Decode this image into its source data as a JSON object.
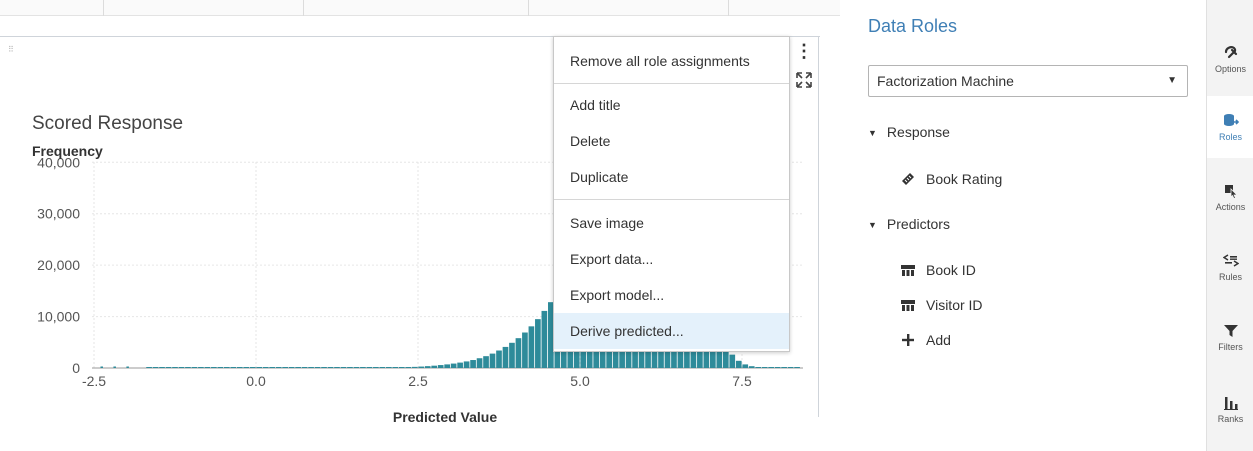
{
  "chart": {
    "title": "Scored Response",
    "y_label": "Frequency",
    "x_label": "Predicted Value"
  },
  "chart_data": {
    "type": "bar",
    "title": "Scored Response",
    "xlabel": "Predicted Value",
    "ylabel": "Frequency",
    "xlim": [
      -2.5,
      8.4
    ],
    "ylim": [
      0,
      42000
    ],
    "x_ticks": [
      "-2.5",
      "0.0",
      "2.5",
      "5.0",
      "7.5"
    ],
    "y_ticks": [
      "0",
      "10,000",
      "20,000",
      "30,000",
      "40,000"
    ],
    "bar_color": "#2e8b9a",
    "grid": true,
    "bin_width": 0.1,
    "bins_start": -1.7,
    "values": [
      5,
      5,
      5,
      5,
      5,
      5,
      5,
      5,
      5,
      5,
      5,
      5,
      5,
      5,
      5,
      5,
      5,
      10,
      10,
      10,
      10,
      10,
      10,
      10,
      10,
      10,
      15,
      15,
      15,
      15,
      20,
      20,
      25,
      30,
      40,
      50,
      60,
      80,
      100,
      130,
      170,
      220,
      280,
      360,
      450,
      570,
      700,
      860,
      1050,
      1280,
      1550,
      1900,
      2300,
      2800,
      3400,
      4100,
      4900,
      5800,
      6900,
      8100,
      9500,
      11100,
      12800,
      14700,
      16700,
      18900,
      21200,
      23600,
      26000,
      28500,
      31000,
      33500,
      35800,
      37900,
      39600,
      40900,
      41600,
      41800,
      41300,
      40100,
      38000,
      35200,
      31800,
      27800,
      23400,
      18900,
      14500,
      10500,
      7100,
      4500,
      2600,
      1400,
      700,
      350,
      170,
      80,
      40,
      20,
      10,
      5,
      5,
      5,
      5,
      5,
      5,
      5,
      5,
      5,
      5,
      5,
      5,
      5,
      5,
      5,
      5,
      5,
      5,
      5,
      5,
      5,
      5,
      5,
      5,
      5,
      5,
      5,
      5,
      5,
      5,
      5,
      5,
      5,
      5,
      5,
      5,
      5,
      5,
      5,
      5,
      5,
      5,
      5,
      5,
      5,
      5,
      5
    ],
    "outliers": [
      {
        "x": -2.4,
        "y": 5
      },
      {
        "x": -2.2,
        "y": 5
      },
      {
        "x": -2.0,
        "y": 5
      }
    ]
  },
  "menu": {
    "items": [
      "Remove all role assignments",
      "Add title",
      "Delete",
      "Duplicate",
      "Save image",
      "Export data...",
      "Export model...",
      "Derive predicted..."
    ]
  },
  "roles": {
    "title": "Data Roles",
    "model_selected": "Factorization Machine",
    "response_label": "Response",
    "response_items": [
      "Book Rating"
    ],
    "predictors_label": "Predictors",
    "predictor_items": [
      "Book ID",
      "Visitor ID"
    ],
    "add_label": "Add"
  },
  "rail": {
    "items": [
      "Options",
      "Roles",
      "Actions",
      "Rules",
      "Filters",
      "Ranks"
    ],
    "active": "Roles"
  },
  "colors": {
    "accent": "#3f7fb5",
    "bar": "#2e8b9a",
    "menu_highlight": "#e4f1fb"
  }
}
